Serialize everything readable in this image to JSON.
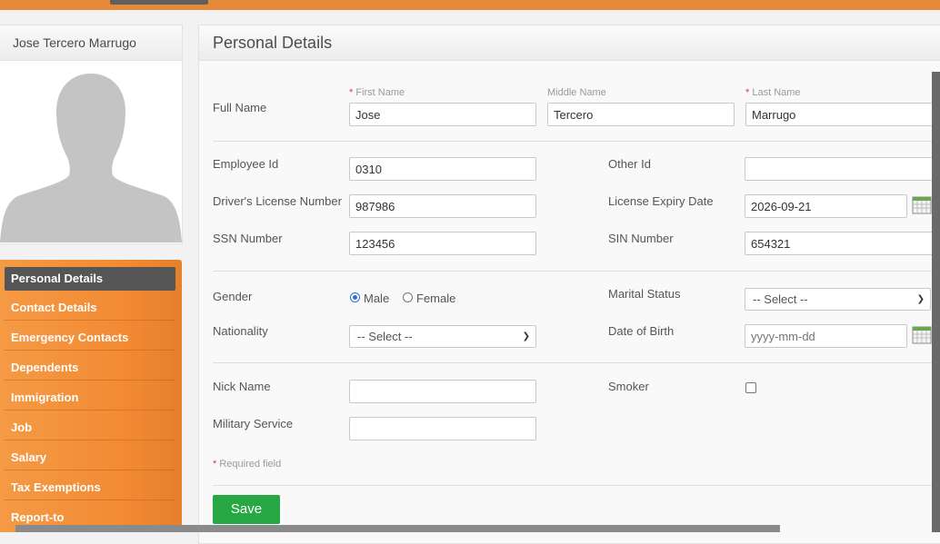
{
  "employee": {
    "name": "Jose Tercero Marrugo"
  },
  "sidebar": {
    "items": [
      {
        "label": "Personal Details",
        "active": true
      },
      {
        "label": "Contact Details"
      },
      {
        "label": "Emergency Contacts"
      },
      {
        "label": "Dependents"
      },
      {
        "label": "Immigration"
      },
      {
        "label": "Job"
      },
      {
        "label": "Salary"
      },
      {
        "label": "Tax Exemptions"
      },
      {
        "label": "Report-to"
      }
    ]
  },
  "form": {
    "title": "Personal Details",
    "full_name_label": "Full Name",
    "first_name_label": "First Name",
    "middle_name_label": "Middle Name",
    "last_name_label": "Last Name",
    "first_name": "Jose",
    "middle_name": "Tercero",
    "last_name": "Marrugo",
    "required_marker": "*",
    "employee_id_label": "Employee Id",
    "employee_id": "0310",
    "other_id_label": "Other Id",
    "other_id": "",
    "drivers_license_label": "Driver's License Number",
    "drivers_license": "987986",
    "license_expiry_label": "License Expiry Date",
    "license_expiry": "2026-09-21",
    "ssn_label": "SSN Number",
    "ssn": "123456",
    "sin_label": "SIN Number",
    "sin": "654321",
    "gender_label": "Gender",
    "gender_options": [
      "Male",
      "Female"
    ],
    "gender_selected": "Male",
    "marital_status_label": "Marital Status",
    "marital_status_value": "-- Select --",
    "nationality_label": "Nationality",
    "nationality_value": "-- Select --",
    "dob_label": "Date of Birth",
    "dob_placeholder": "yyyy-mm-dd",
    "nick_name_label": "Nick Name",
    "nick_name": "",
    "smoker_label": "Smoker",
    "smoker_checked": false,
    "military_label": "Military Service",
    "military": "",
    "required_note": "Required field",
    "save_label": "Save"
  },
  "colors": {
    "accent": "#f28a33",
    "save": "#28a745",
    "required": "#e53535"
  }
}
